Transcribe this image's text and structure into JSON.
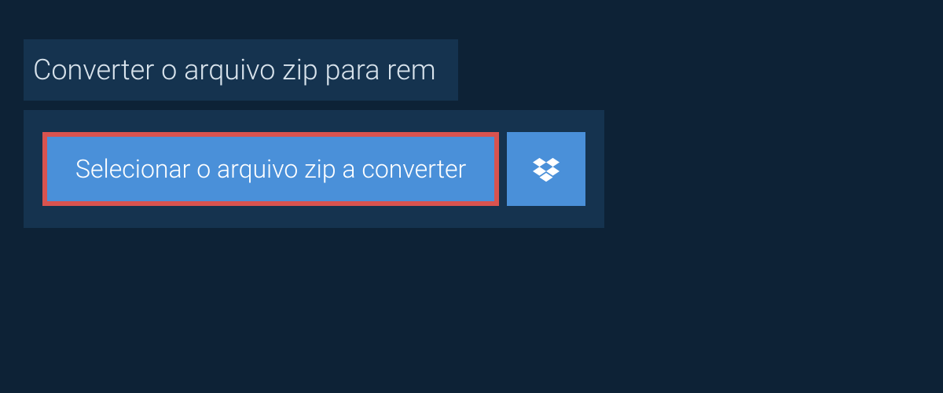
{
  "header": {
    "title": "Converter o arquivo zip para rem"
  },
  "buttons": {
    "select_file_label": "Selecionar o arquivo zip a converter"
  },
  "colors": {
    "bg_outer": "#0d2236",
    "bg_panel": "#15334f",
    "button_bg": "#4a90d9",
    "highlight_border": "#d9534f",
    "text_light": "#d8e3ec",
    "text_white": "#ffffff"
  }
}
